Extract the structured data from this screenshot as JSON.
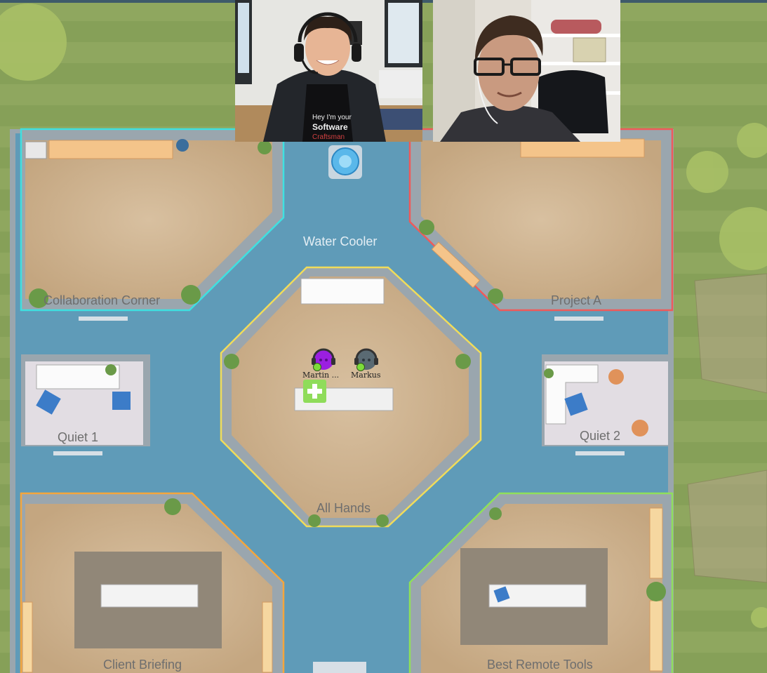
{
  "rooms": {
    "water_cooler": "Water Cooler",
    "collaboration_corner": "Collaboration Corner",
    "project_a": "Project A",
    "all_hands": "All Hands",
    "quiet_1": "Quiet 1",
    "quiet_2": "Quiet 2",
    "client_briefing": "Client Briefing",
    "best_remote_tools": "Best Remote Tools"
  },
  "participants": [
    {
      "name": "Martin ...",
      "color": "#9b1fe0",
      "status": "online"
    },
    {
      "name": "Markus",
      "color": "#5a6a73",
      "status": "online"
    }
  ],
  "video_tiles": [
    {
      "person": "host-with-headset",
      "shirt_text": "Hey I’m your Software Craftsman"
    },
    {
      "person": "participant-with-glasses"
    }
  ],
  "colors": {
    "hallway": "#5f9bb8",
    "grass": "#8ea45e",
    "room_floor": "#c9ad88",
    "quiet_floor": "#e2dde3",
    "collab_border": "#3fe0e0",
    "project_a_border": "#ef5a5a",
    "all_hands_border": "#f0dc5a",
    "client_border": "#f5a63c",
    "tools_border": "#8fe05a",
    "status_online": "#7ddc3a",
    "add_button": "#8fdc5a"
  },
  "add_button_icon": "plus-icon"
}
